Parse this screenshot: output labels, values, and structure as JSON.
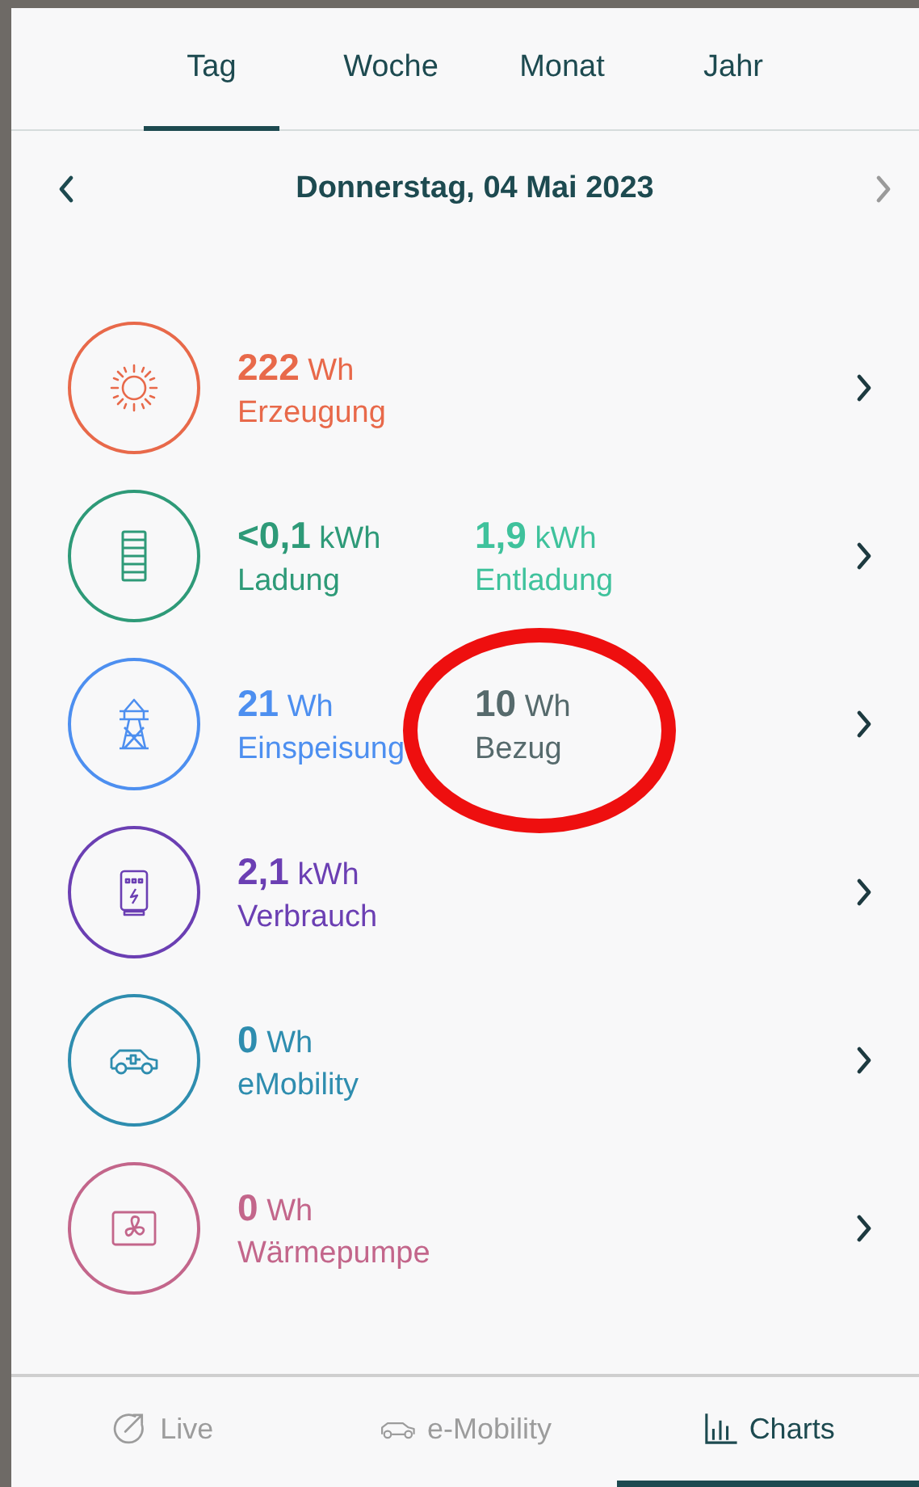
{
  "tabs": [
    {
      "label": "Tag",
      "selected": true
    },
    {
      "label": "Woche",
      "selected": false
    },
    {
      "label": "Monat",
      "selected": false
    },
    {
      "label": "Jahr",
      "selected": false
    }
  ],
  "date_nav": {
    "title": "Donnerstag, 04 Mai 2023",
    "prev_disabled": false,
    "next_disabled": true
  },
  "rows": [
    {
      "kind": "sun",
      "color": "#e8694a",
      "primary": {
        "value": "222",
        "unit": "Wh",
        "label": "Erzeugung"
      }
    },
    {
      "kind": "battery",
      "color": "#2e9a78",
      "primary": {
        "value": "<0,1",
        "unit": "kWh",
        "label": "Ladung"
      },
      "secondary": {
        "value": "1,9",
        "unit": "kWh",
        "label": "Entladung",
        "color": "#3fc29c",
        "highlighted": false
      }
    },
    {
      "kind": "grid",
      "color": "#4d8ff0",
      "primary": {
        "value": "21",
        "unit": "Wh",
        "label": "Einspeisung"
      },
      "secondary": {
        "value": "10",
        "unit": "Wh",
        "label": "Bezug",
        "color": "#566a6c",
        "highlighted": true
      }
    },
    {
      "kind": "house",
      "color": "#6b3fb3",
      "primary": {
        "value": "2,1",
        "unit": "kWh",
        "label": "Verbrauch"
      }
    },
    {
      "kind": "car",
      "color": "#2e8daf",
      "primary": {
        "value": "0",
        "unit": "Wh",
        "label": "eMobility"
      }
    },
    {
      "kind": "heatpump",
      "color": "#c3668b",
      "primary": {
        "value": "0",
        "unit": "Wh",
        "label": "Wärmepumpe"
      }
    }
  ],
  "bottom_nav": [
    {
      "kind": "live",
      "label": "Live",
      "selected": false
    },
    {
      "kind": "car",
      "label": "e-Mobility",
      "selected": false
    },
    {
      "kind": "charts",
      "label": "Charts",
      "selected": true
    }
  ]
}
